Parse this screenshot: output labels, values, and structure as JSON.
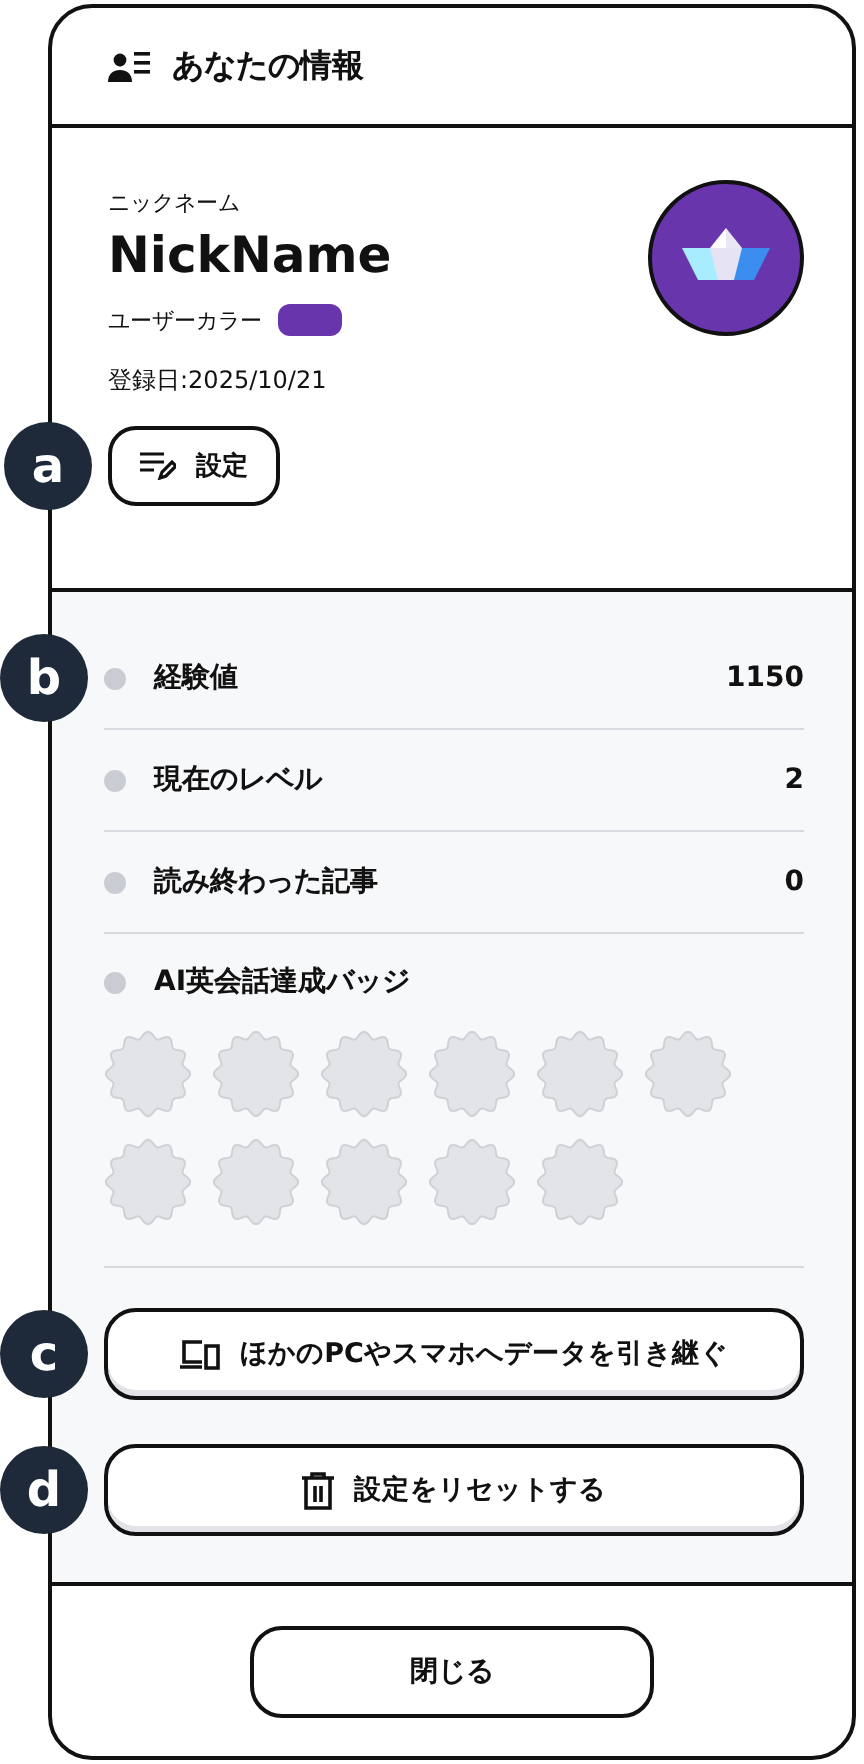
{
  "header": {
    "title": "あなたの情報"
  },
  "profile": {
    "nickname_label": "ニックネーム",
    "nickname": "NickName",
    "user_color": {
      "label": "ユーザーカラー",
      "color": "#6835ad"
    },
    "registered": "登録日:2025/10/21",
    "settings_button": "設定"
  },
  "stats": [
    {
      "label": "経験値",
      "value": "1150"
    },
    {
      "label": "現在のレベル",
      "value": "2"
    },
    {
      "label": "読み終わった記事",
      "value": "0"
    }
  ],
  "badges": {
    "label": "AI英会話達成バッジ",
    "items": [
      {
        "earned": false
      },
      {
        "earned": false
      },
      {
        "earned": false
      },
      {
        "earned": false
      },
      {
        "earned": false
      },
      {
        "earned": false
      },
      {
        "earned": false
      },
      {
        "earned": false
      },
      {
        "earned": false
      },
      {
        "earned": false
      },
      {
        "earned": false
      }
    ]
  },
  "actions": [
    {
      "kind": "transfer",
      "label": "ほかのPCやスマホへデータを引き継ぐ"
    },
    {
      "kind": "reset",
      "label": "設定をリセットする"
    }
  ],
  "close_button": "閉じる",
  "callouts": [
    "a",
    "b",
    "c",
    "d"
  ]
}
